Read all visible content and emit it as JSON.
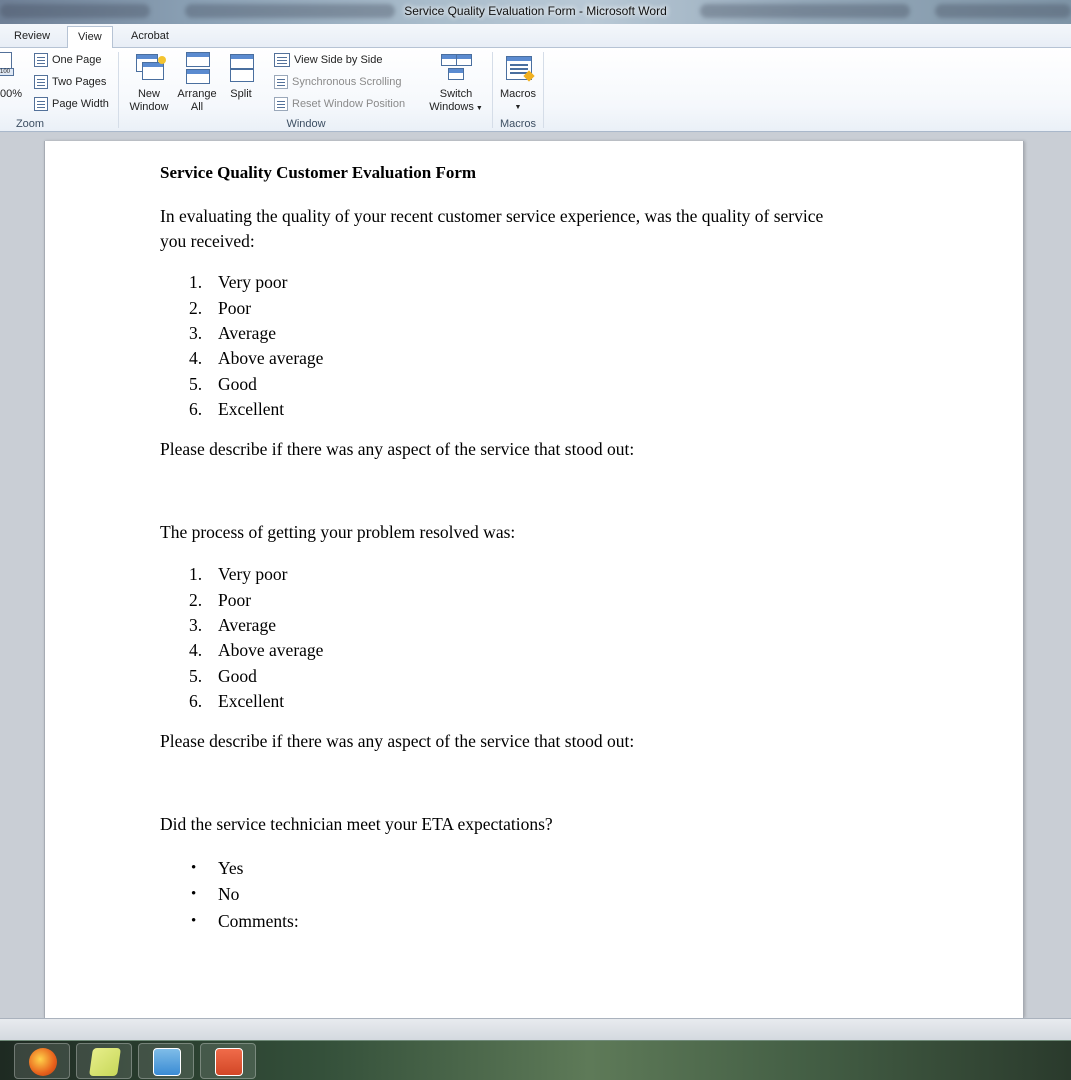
{
  "window": {
    "title": "Service Quality Evaluation Form  -  Microsoft Word"
  },
  "ribbon_tabs": [
    {
      "label": "Review"
    },
    {
      "label": "View"
    },
    {
      "label": "Acrobat"
    }
  ],
  "ribbon": {
    "zoom_group": {
      "zoom_pct": "00%",
      "one_page": "One Page",
      "two_pages": "Two Pages",
      "page_width": "Page Width",
      "label": "Zoom"
    },
    "window_group": {
      "new_window_1": "New",
      "new_window_2": "Window",
      "arrange_all_1": "Arrange",
      "arrange_all_2": "All",
      "split": "Split",
      "view_side_by_side": "View Side by Side",
      "synchronous_scrolling": "Synchronous Scrolling",
      "reset_window_position": "Reset Window Position",
      "switch_windows_1": "Switch",
      "switch_windows_2": "Windows",
      "label": "Window"
    },
    "macros_group": {
      "macros": "Macros",
      "label": "Macros"
    }
  },
  "document": {
    "title": "Service Quality Customer Evaluation Form",
    "q1_line1": "In evaluating the quality of your recent customer service experience, was the quality of service",
    "q1_line2": "you received:",
    "q1_options": [
      {
        "num": "1.",
        "label": "Very poor"
      },
      {
        "num": "2.",
        "label": "Poor"
      },
      {
        "num": "3.",
        "label": "Average"
      },
      {
        "num": "4.",
        "label": "Above average"
      },
      {
        "num": "5.",
        "label": "Good"
      },
      {
        "num": "6.",
        "label": "Excellent"
      }
    ],
    "q1_describe": "Please describe if there was any aspect of the service that stood out:",
    "q2": "The process of getting your problem resolved was:",
    "q2_options": [
      {
        "num": "1.",
        "label": "Very poor"
      },
      {
        "num": "2.",
        "label": "Poor"
      },
      {
        "num": "3.",
        "label": "Average"
      },
      {
        "num": "4.",
        "label": "Above average"
      },
      {
        "num": "5.",
        "label": "Good"
      },
      {
        "num": "6.",
        "label": "Excellent"
      }
    ],
    "q2_describe": "Please describe if there was any aspect of the service that stood out:",
    "q3": "Did the service technician meet your ETA expectations?",
    "q3_options": [
      {
        "bullet": "•",
        "label": "Yes"
      },
      {
        "bullet": "•",
        "label": "No"
      },
      {
        "bullet": "•",
        "label": "Comments:"
      }
    ]
  },
  "taskbar": {
    "items": [
      {
        "icon": "firefox-icon",
        "color": "#e8621c"
      },
      {
        "icon": "sticky-notes-icon",
        "color": "#c8d85a"
      },
      {
        "icon": "lync-icon",
        "color": "#3a8bd4"
      },
      {
        "icon": "powerpoint-icon",
        "color": "#d24726"
      }
    ]
  }
}
